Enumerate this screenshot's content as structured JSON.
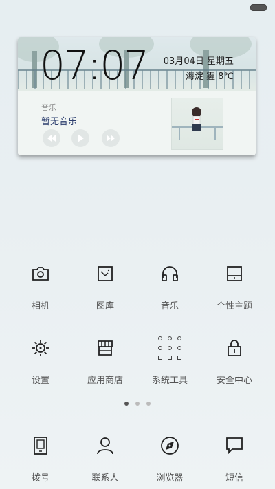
{
  "widget": {
    "time": "07:07",
    "date": "03月04日  星期五",
    "weather": "海淀  霾  8℃",
    "music_label": "音乐",
    "music_title": "暂无音乐"
  },
  "apps_row1": [
    {
      "label": "相机",
      "icon": "camera-icon"
    },
    {
      "label": "图库",
      "icon": "gallery-icon"
    },
    {
      "label": "音乐",
      "icon": "headphones-icon"
    },
    {
      "label": "个性主题",
      "icon": "theme-icon"
    }
  ],
  "apps_row2": [
    {
      "label": "设置",
      "icon": "gear-icon"
    },
    {
      "label": "应用商店",
      "icon": "store-icon"
    },
    {
      "label": "系统工具",
      "icon": "tools-folder-icon"
    },
    {
      "label": "安全中心",
      "icon": "lock-icon"
    }
  ],
  "dock": [
    {
      "label": "拨号",
      "icon": "phone-icon"
    },
    {
      "label": "联系人",
      "icon": "contacts-icon"
    },
    {
      "label": "浏览器",
      "icon": "browser-icon"
    },
    {
      "label": "短信",
      "icon": "message-icon"
    }
  ],
  "page_indicator": {
    "pages": 3,
    "active": 1
  }
}
